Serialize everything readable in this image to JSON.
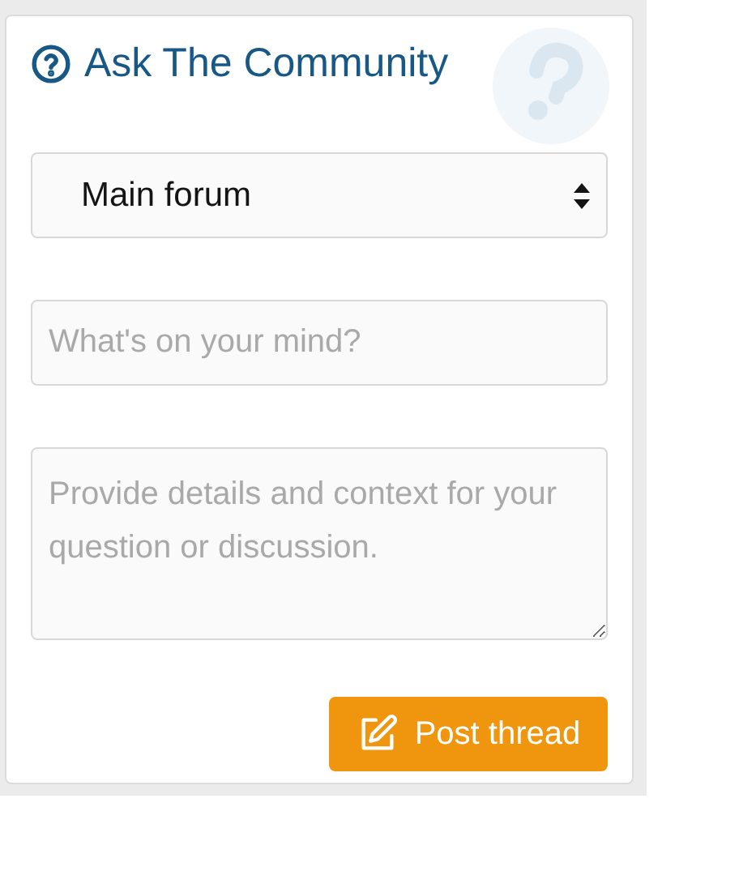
{
  "widget": {
    "title": "Ask The Community"
  },
  "forum_select": {
    "value": "Main forum"
  },
  "title_field": {
    "placeholder": "What's on your mind?"
  },
  "details_field": {
    "placeholder": "Provide details and context for your question or discussion."
  },
  "submit_button": {
    "label": "Post thread"
  }
}
